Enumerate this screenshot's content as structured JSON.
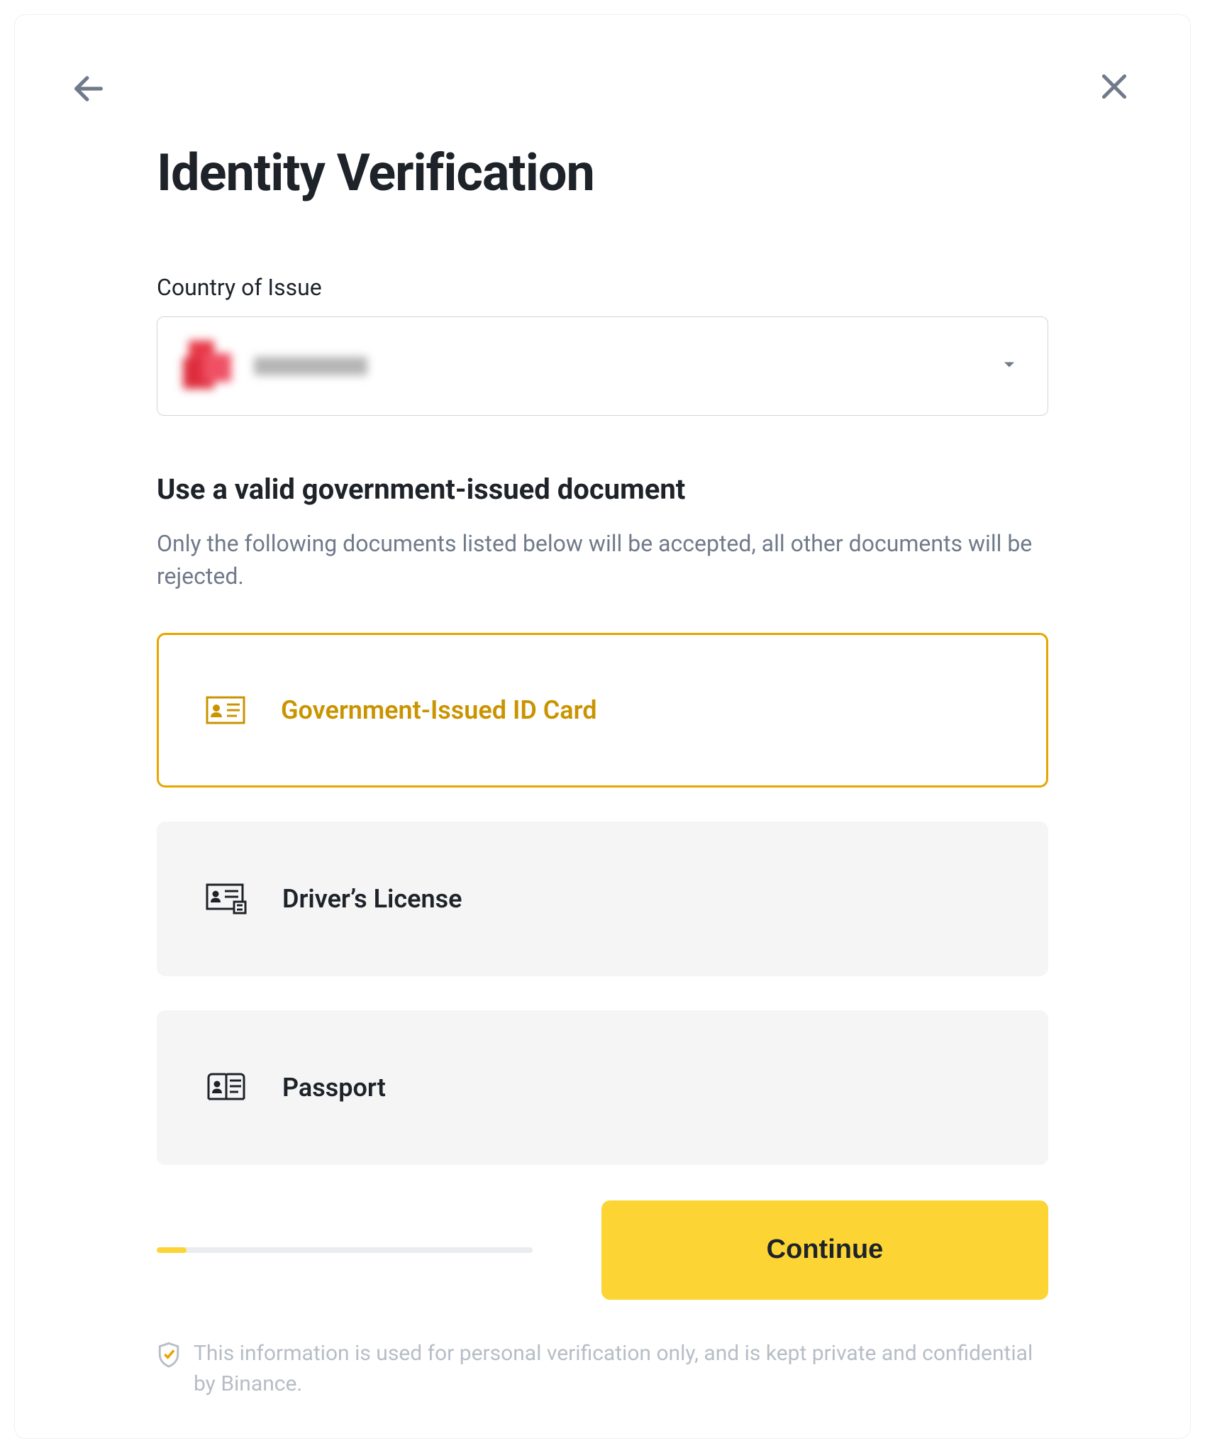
{
  "header": {
    "title": "Identity Verification"
  },
  "country": {
    "label": "Country of Issue",
    "selected_value": "[redacted]"
  },
  "document_section": {
    "subtitle": "Use a valid government-issued document",
    "helper": "Only the following documents listed below will be accepted, all other documents will be rejected.",
    "options": [
      {
        "id": "id-card",
        "label": "Government-Issued ID Card",
        "selected": true
      },
      {
        "id": "drivers-license",
        "label": "Driver’s License",
        "selected": false
      },
      {
        "id": "passport",
        "label": "Passport",
        "selected": false
      }
    ]
  },
  "footer": {
    "continue_label": "Continue",
    "progress_percent": 8
  },
  "disclaimer": {
    "text": "This information is used for personal verification only, and is kept private and confidential by Binance."
  },
  "colors": {
    "accent": "#FCD535",
    "accent_dark": "#E8A500",
    "text_primary": "#1E2329",
    "text_secondary": "#707A8A",
    "text_muted": "#B7BDC6",
    "panel_bg": "#F5F5F5"
  }
}
